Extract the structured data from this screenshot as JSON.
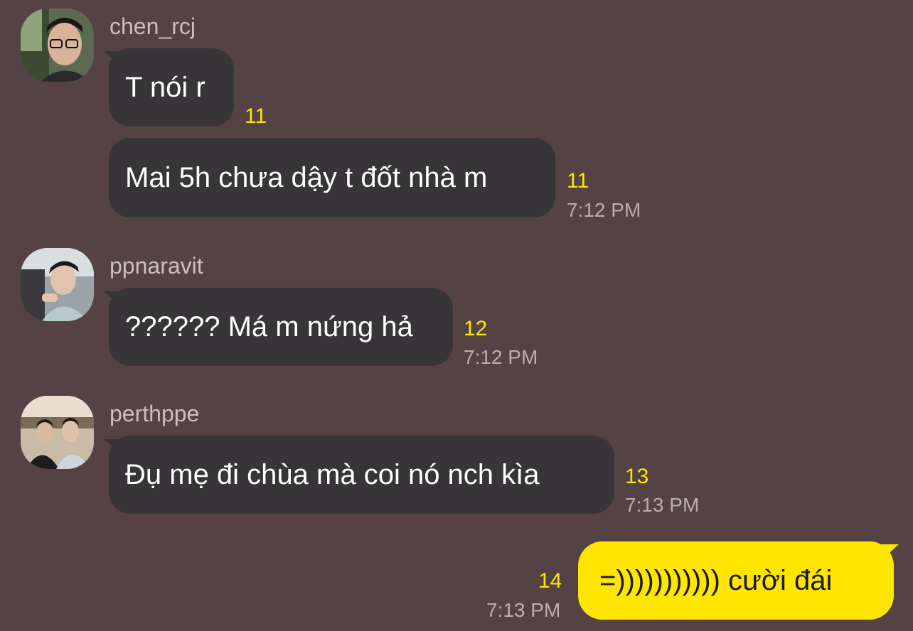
{
  "messages": [
    {
      "sender": "chen_rcj",
      "avatar_icon": "user-photo-avatar",
      "bubbles": [
        {
          "text": "T nói r",
          "unread": "11",
          "time": ""
        },
        {
          "text": "Mai 5h chưa dậy t đốt nhà m",
          "unread": "11",
          "time": "7:12 PM"
        }
      ]
    },
    {
      "sender": "ppnaravit",
      "avatar_icon": "user-photo-avatar",
      "bubbles": [
        {
          "text": "?????? Má m nứng hả",
          "unread": "12",
          "time": "7:12 PM"
        }
      ]
    },
    {
      "sender": "perthppe",
      "avatar_icon": "user-photo-avatar",
      "bubbles": [
        {
          "text": "Đụ mẹ đi chùa mà coi nó nch kìa",
          "unread": "13",
          "time": "7:13 PM"
        }
      ]
    }
  ],
  "my_message": {
    "text": "=))))))))))) cười đái",
    "unread": "14",
    "time": "7:13 PM"
  },
  "colors": {
    "background": "#544244",
    "bubble_other": "#373537",
    "bubble_mine": "#ffe600",
    "unread_count": "#ffe600"
  }
}
